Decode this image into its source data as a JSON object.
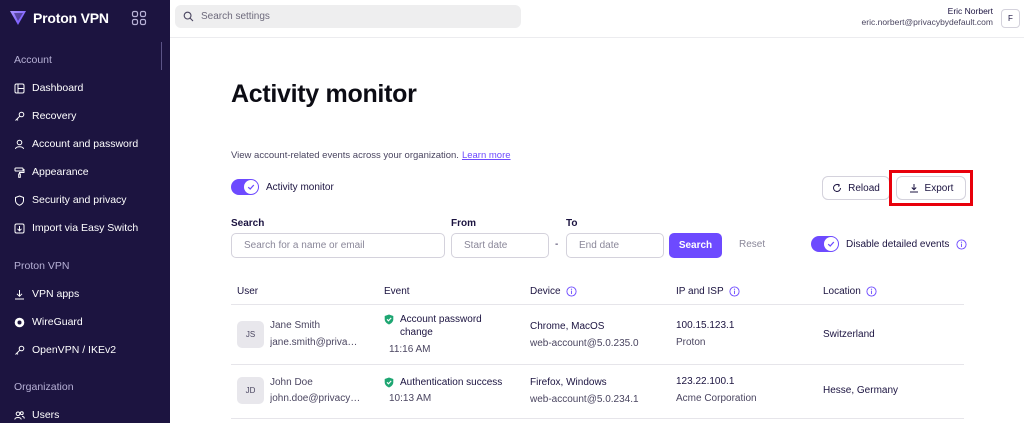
{
  "app": {
    "brand": "Proton VPN"
  },
  "sidebar": {
    "sections": [
      {
        "title": "Account",
        "items": [
          {
            "label": "Dashboard",
            "icon": "dashboard-icon"
          },
          {
            "label": "Recovery",
            "icon": "key-icon"
          },
          {
            "label": "Account and password",
            "icon": "user-icon"
          },
          {
            "label": "Appearance",
            "icon": "paint-roller-icon"
          },
          {
            "label": "Security and privacy",
            "icon": "shield-icon"
          },
          {
            "label": "Import via Easy Switch",
            "icon": "import-icon"
          }
        ]
      },
      {
        "title": "Proton VPN",
        "items": [
          {
            "label": "VPN apps",
            "icon": "download-icon"
          },
          {
            "label": "WireGuard",
            "icon": "wireguard-icon"
          },
          {
            "label": "OpenVPN / IKEv2",
            "icon": "key-icon"
          }
        ]
      },
      {
        "title": "Organization",
        "items": [
          {
            "label": "Users",
            "icon": "users-icon"
          }
        ]
      }
    ]
  },
  "topbar": {
    "search_placeholder": "Search settings",
    "user_name": "Eric Norbert",
    "user_email": "eric.norbert@privacybydefault.com",
    "avatar_initial": "F"
  },
  "main": {
    "title": "Activity monitor",
    "description": "View account-related events across your organization.",
    "learn_more": "Learn more",
    "activity_toggle": {
      "label": "Activity monitor",
      "on": true
    },
    "reload_label": "Reload",
    "export_label": "Export",
    "filters": {
      "search_label": "Search",
      "search_placeholder": "Search for a name or email",
      "from_label": "From",
      "from_placeholder": "Start date",
      "to_label": "To",
      "to_placeholder": "End date",
      "dash": "-",
      "search_button": "Search",
      "reset_button": "Reset",
      "detailed_toggle": {
        "label": "Disable detailed events",
        "on": true
      }
    },
    "table": {
      "headers": [
        "User",
        "Event",
        "Device",
        "IP and ISP",
        "Location"
      ],
      "rows": [
        {
          "initials": "JS",
          "name": "Jane Smith",
          "email": "jane.smith@privacybydefault.com",
          "event": "Account password change",
          "event_line1": "Account password",
          "event_line2": "change",
          "time": "11:16 AM",
          "device": "Chrome, MacOS",
          "device_sub": "web-account@5.0.235.0",
          "ip": "100.15.123.1",
          "isp": "Proton",
          "location": "Switzerland"
        },
        {
          "initials": "JD",
          "name": "John Doe",
          "email": "john.doe@privacybydefault.com",
          "event": "Authentication success",
          "event_line1": "Authentication success",
          "event_line2": "",
          "time": "10:13 AM",
          "device": "Firefox, Windows",
          "device_sub": "web-account@5.0.234.1",
          "ip": "123.22.100.1",
          "isp": "Acme Corporation",
          "location": "Hesse, Germany"
        }
      ]
    }
  },
  "colors": {
    "sidebar_bg": "#1c1440",
    "accent": "#6d4aff",
    "success": "#1ea672",
    "highlight": "#e8000b"
  }
}
